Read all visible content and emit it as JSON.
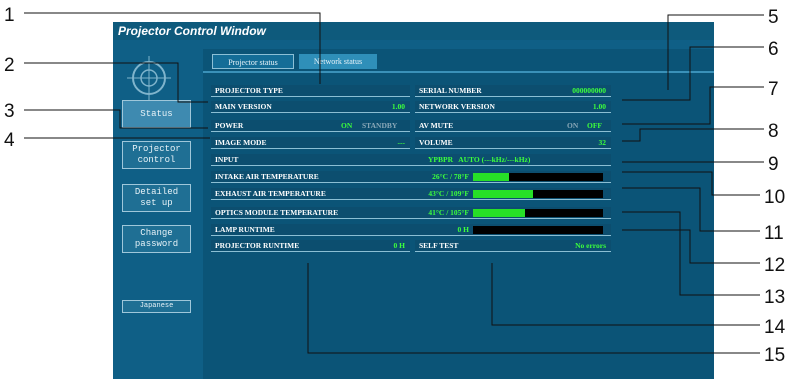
{
  "window": {
    "title": "Projector Control Window"
  },
  "sidebar": {
    "buttons": [
      {
        "label": "Status"
      },
      {
        "label": "Projector\ncontrol"
      },
      {
        "label": "Detailed\nset up"
      },
      {
        "label": "Change\npassword"
      }
    ],
    "language_button": "Japanese"
  },
  "tabs": [
    {
      "label": "Projector status"
    },
    {
      "label": "Network status"
    }
  ],
  "status": {
    "projector_type": {
      "label": "PROJECTOR TYPE"
    },
    "main_version": {
      "label": "MAIN VERSION",
      "value": "1.00"
    },
    "power": {
      "label": "POWER",
      "value_on": "ON",
      "value_standby": "STANDBY"
    },
    "image_mode": {
      "label": "IMAGE MODE",
      "value": "---"
    },
    "serial_number": {
      "label": "SERIAL NUMBER",
      "value": "000000000"
    },
    "network_version": {
      "label": "NETWORK VERSION",
      "value": "1.00"
    },
    "av_mute": {
      "label": "AV MUTE",
      "value_on": "ON",
      "value_off": "OFF"
    },
    "volume": {
      "label": "VOLUME",
      "value": "32"
    },
    "input": {
      "label": "INPUT",
      "value": "YPBPR   AUTO (---kHz/---kHz)"
    },
    "intake_air": {
      "label": "INTAKE AIR TEMPERATURE",
      "value": "26°C / 78°F",
      "level": 0.28
    },
    "exhaust_air": {
      "label": "EXHAUST AIR TEMPERATURE",
      "value": "43°C / 109°F",
      "level": 0.46
    },
    "optics_module": {
      "label": "OPTICS MODULE TEMPERATURE",
      "value": "41°C / 105°F",
      "level": 0.4
    },
    "lamp_runtime": {
      "label": "LAMP RUNTIME",
      "value": "0 H",
      "level": 0.0
    },
    "projector_runtime": {
      "label": "PROJECTOR RUNTIME",
      "value": "0 H"
    },
    "self_test": {
      "label": "SELF TEST",
      "value": "No errors"
    }
  },
  "callouts": [
    "1",
    "2",
    "3",
    "4",
    "5",
    "6",
    "7",
    "8",
    "9",
    "10",
    "11",
    "12",
    "13",
    "14",
    "15"
  ],
  "colors": {
    "window_bg": "#0f5f86",
    "value_green": "#3cff3c",
    "bar_fill": "#27e027"
  }
}
